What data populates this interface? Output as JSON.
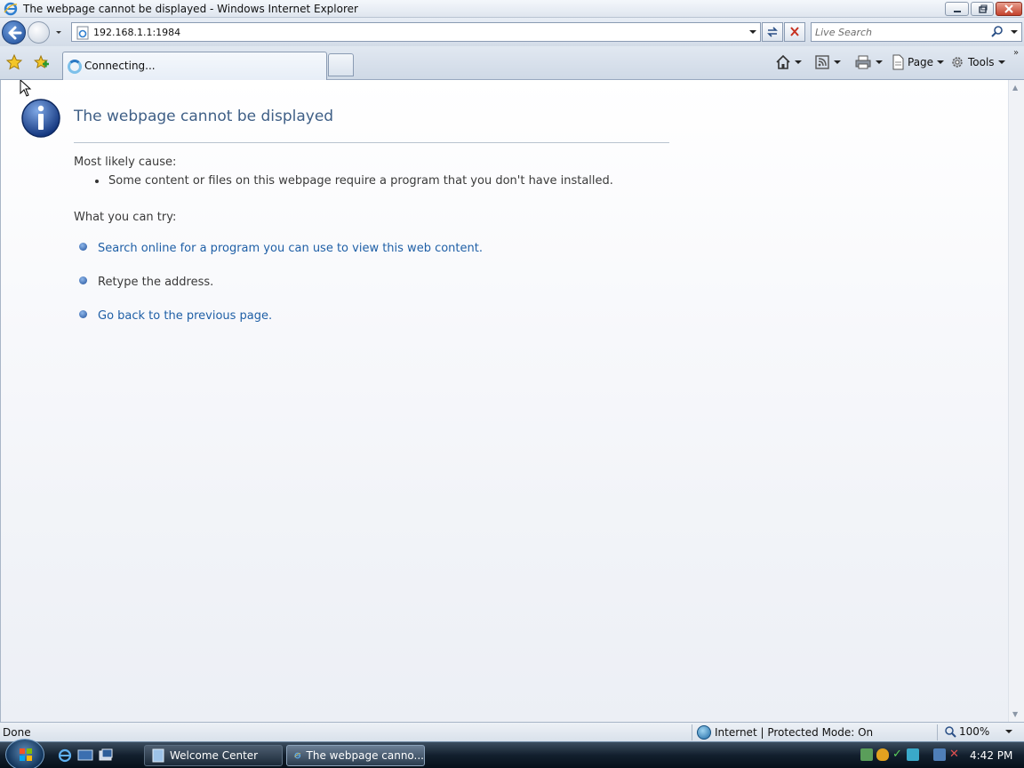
{
  "window": {
    "title": "The webpage cannot be displayed - Windows Internet Explorer"
  },
  "address_bar": {
    "url": "192.168.1.1:1984"
  },
  "search": {
    "placeholder": "Live Search"
  },
  "tab": {
    "label": "Connecting..."
  },
  "command_bar": {
    "page_label": "Page",
    "tools_label": "Tools"
  },
  "error_page": {
    "title": "The webpage cannot be displayed",
    "cause_heading": "Most likely cause:",
    "cause_item": "Some content or files on this webpage require a program that you don't have installed.",
    "try_heading": "What you can try:",
    "try_items": [
      "Search online for a program you can use to view this web content.",
      "Retype the address.",
      "Go back to the previous page."
    ]
  },
  "status_bar": {
    "status": "Done",
    "zone": "Internet | Protected Mode: On",
    "zoom": "100%"
  },
  "taskbar": {
    "items": [
      "Welcome Center",
      "The webpage canno..."
    ],
    "clock": "4:42 PM"
  },
  "colors": {
    "link": "#1f5fa6",
    "title": "#3f5f86",
    "taskbar": "#13202e"
  }
}
